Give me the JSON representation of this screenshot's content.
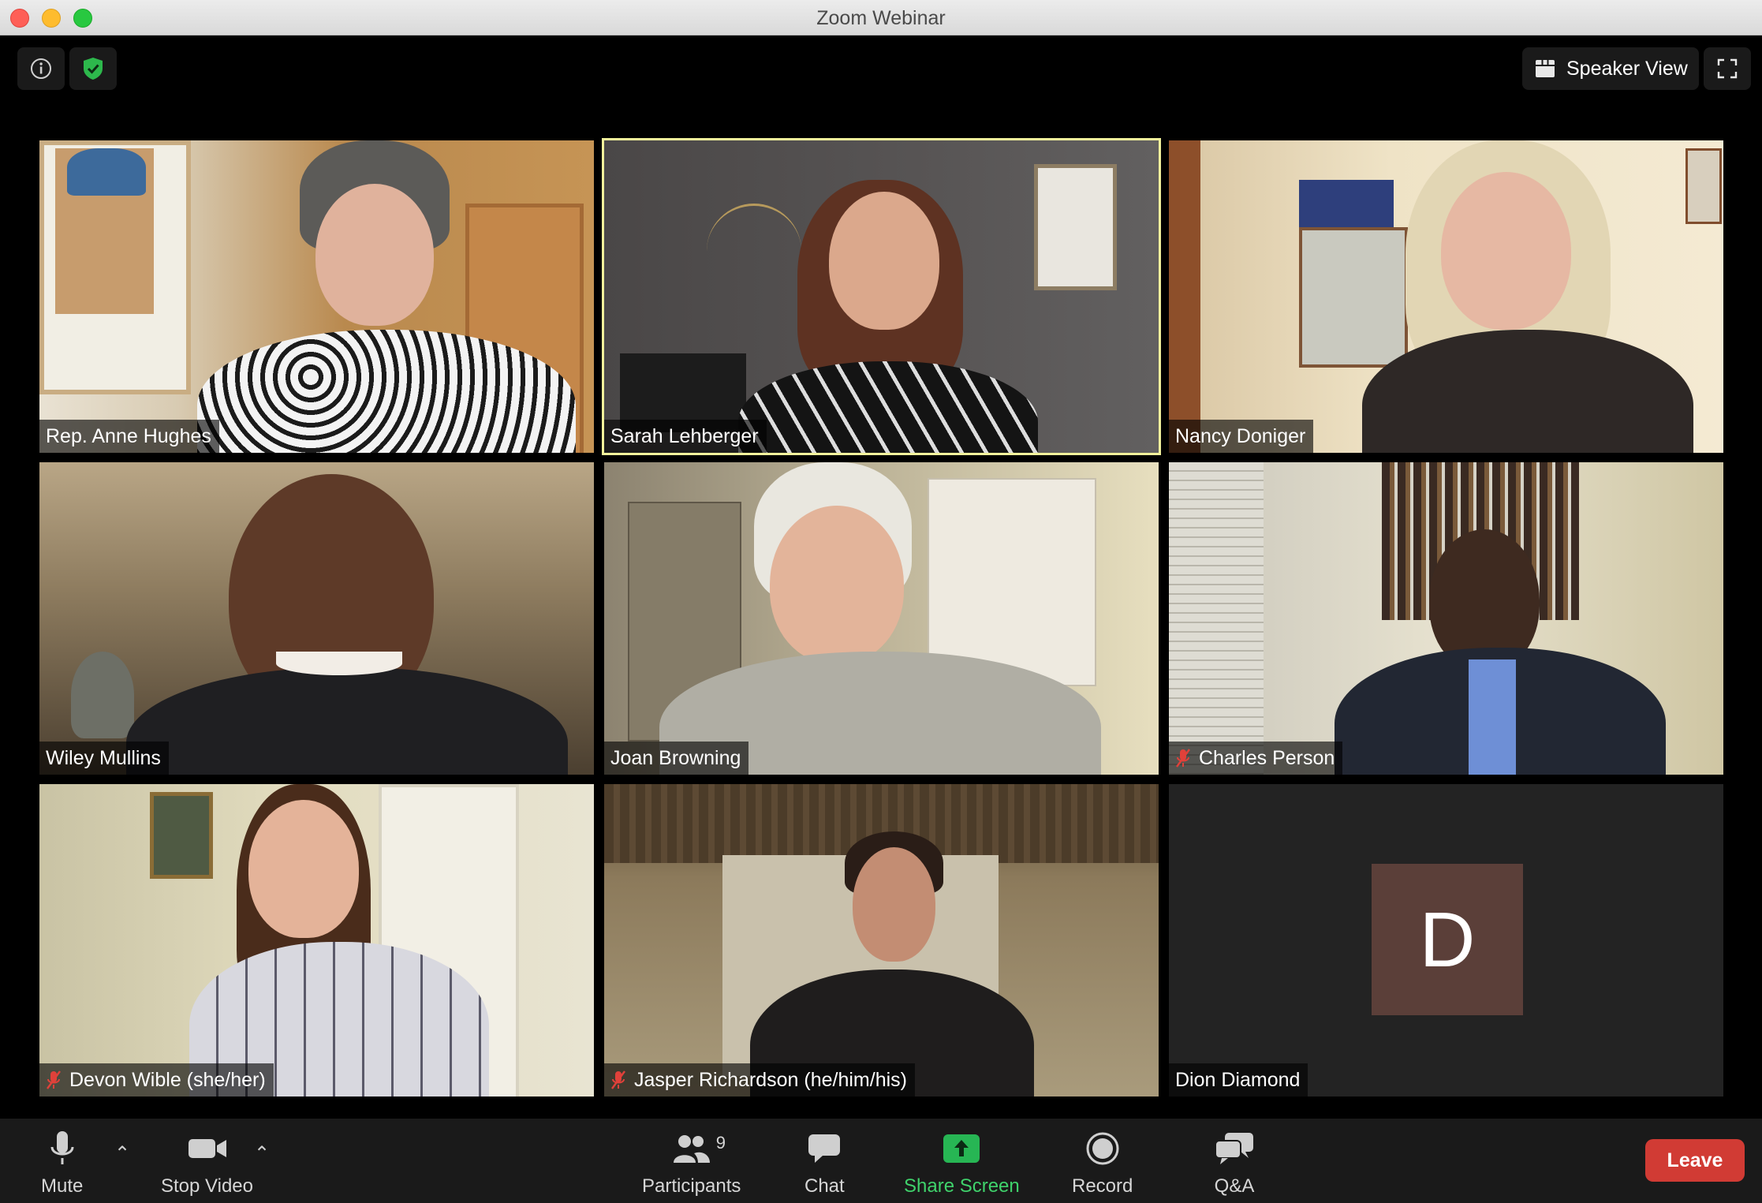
{
  "window": {
    "title": "Zoom Webinar"
  },
  "top_controls": {
    "view_label": "Speaker View"
  },
  "participants": [
    {
      "name": "Rep. Anne Hughes",
      "muted": false
    },
    {
      "name": "Sarah Lehberger",
      "muted": false
    },
    {
      "name": "Nancy Doniger",
      "muted": false
    },
    {
      "name": "Wiley Mullins",
      "muted": false
    },
    {
      "name": "Joan Browning",
      "muted": false
    },
    {
      "name": "Charles Person",
      "muted": true
    },
    {
      "name": "Devon Wible (she/her)",
      "muted": true
    },
    {
      "name": "Jasper Richardson (he/him/his)",
      "muted": true
    },
    {
      "name": "Dion Diamond",
      "muted": false,
      "avatar_letter": "D"
    }
  ],
  "toolbar": {
    "mute_label": "Mute",
    "video_label": "Stop Video",
    "participants_label": "Participants",
    "participants_count": "9",
    "chat_label": "Chat",
    "share_label": "Share Screen",
    "record_label": "Record",
    "qa_label": "Q&A",
    "leave_label": "Leave",
    "caret": "⌃"
  },
  "colors": {
    "active_speaker_border": "#f1f19b",
    "share_green": "#3fd26b",
    "leave_red": "#d13b34",
    "secure_green": "#2db84c",
    "avatar_bg": "#5b3f39"
  }
}
